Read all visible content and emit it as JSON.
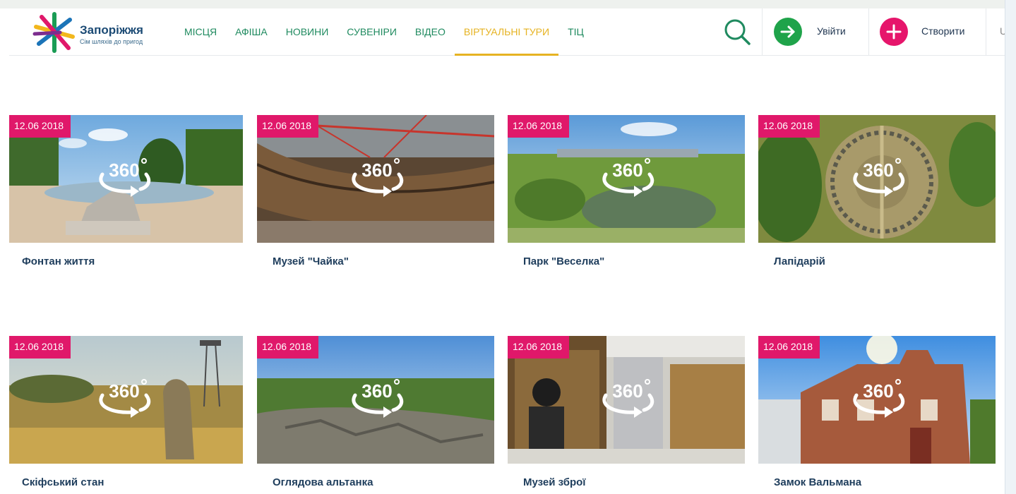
{
  "header": {
    "logo_title": "Запоріжжя",
    "logo_subtitle": "Сім шляхів до пригод",
    "nav": [
      {
        "label": "МІСЦЯ"
      },
      {
        "label": "АФІША"
      },
      {
        "label": "НОВИНИ"
      },
      {
        "label": "СУВЕНІРИ"
      },
      {
        "label": "ВІДЕО"
      },
      {
        "label": "ВІРТУАЛЬНІ ТУРИ",
        "active": true
      },
      {
        "label": "ТІЦ"
      }
    ],
    "login_label": "Увійти",
    "create_label": "Створити",
    "lang_label": "U"
  },
  "tours": [
    {
      "date": "12.06 2018",
      "title": "Фонтан життя"
    },
    {
      "date": "12.06 2018",
      "title": "Музей \"Чайка\""
    },
    {
      "date": "12.06 2018",
      "title": "Парк \"Веселка\""
    },
    {
      "date": "12.06 2018",
      "title": "Лапідарій"
    },
    {
      "date": "12.06 2018",
      "title": "Скіфський стан"
    },
    {
      "date": "12.06 2018",
      "title": "Оглядова альтанка"
    },
    {
      "date": "12.06 2018",
      "title": "Музей зброї"
    },
    {
      "date": "12.06 2018",
      "title": "Замок Вальмана"
    }
  ],
  "badge_360": "360",
  "colors": {
    "nav_green": "#1f8a5f",
    "nav_active": "#e6b322",
    "date_badge": "#e0186a",
    "login_circle": "#1fa34a",
    "create_circle": "#e6156b",
    "title_text": "#1e3d5c"
  },
  "icons": [
    "logo-star-icon",
    "search-icon",
    "arrow-right-icon",
    "plus-icon",
    "rotate-360-icon"
  ]
}
